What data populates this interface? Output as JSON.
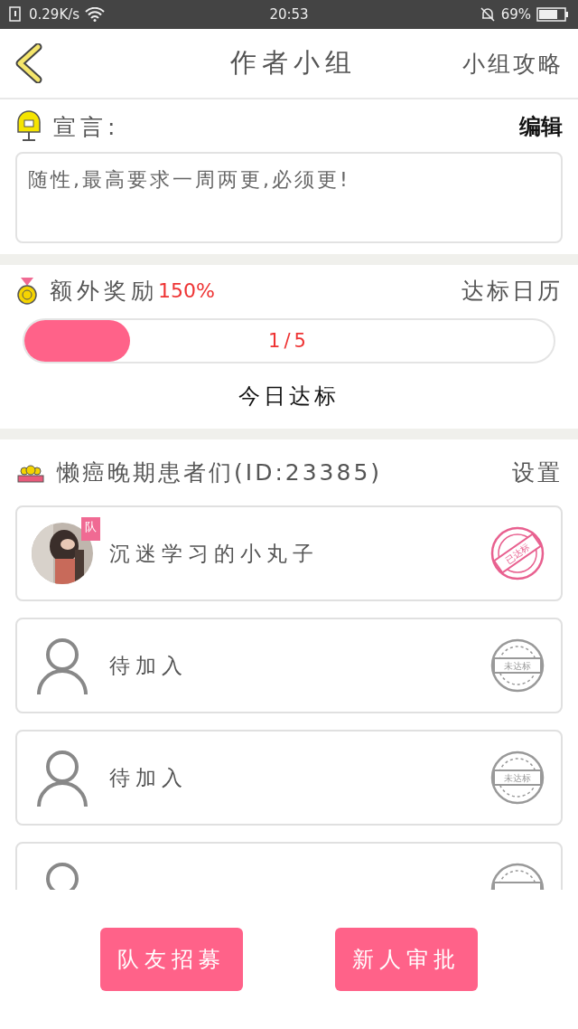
{
  "status_bar": {
    "speed": "0.29K/s",
    "time": "20:53",
    "battery": "69%"
  },
  "header": {
    "title": "作者小组",
    "action": "小组攻略"
  },
  "declaration": {
    "label": "宣言:",
    "edit": "编辑",
    "text": "随性,最高要求一周两更,必须更!"
  },
  "reward": {
    "label": "额外奖励",
    "percent": "150%",
    "calendar": "达标日历",
    "level": 0.2,
    "progress": "1/5",
    "today": "今日达标"
  },
  "team": {
    "name": "懒癌晚期患者们(ID:23385)",
    "settings": "设置"
  },
  "members": [
    {
      "kind": "member",
      "name": "沉迷学习的小丸子",
      "badge": "队",
      "achieved": true,
      "stamp": "已达标"
    },
    {
      "kind": "empty",
      "name": "待加入",
      "achieved": false,
      "stamp": "未达标"
    },
    {
      "kind": "empty",
      "name": "待加入",
      "achieved": false,
      "stamp": "未达标"
    },
    {
      "kind": "empty",
      "achieved": false
    }
  ],
  "buttons": [
    "队友招募",
    "新人审批"
  ]
}
